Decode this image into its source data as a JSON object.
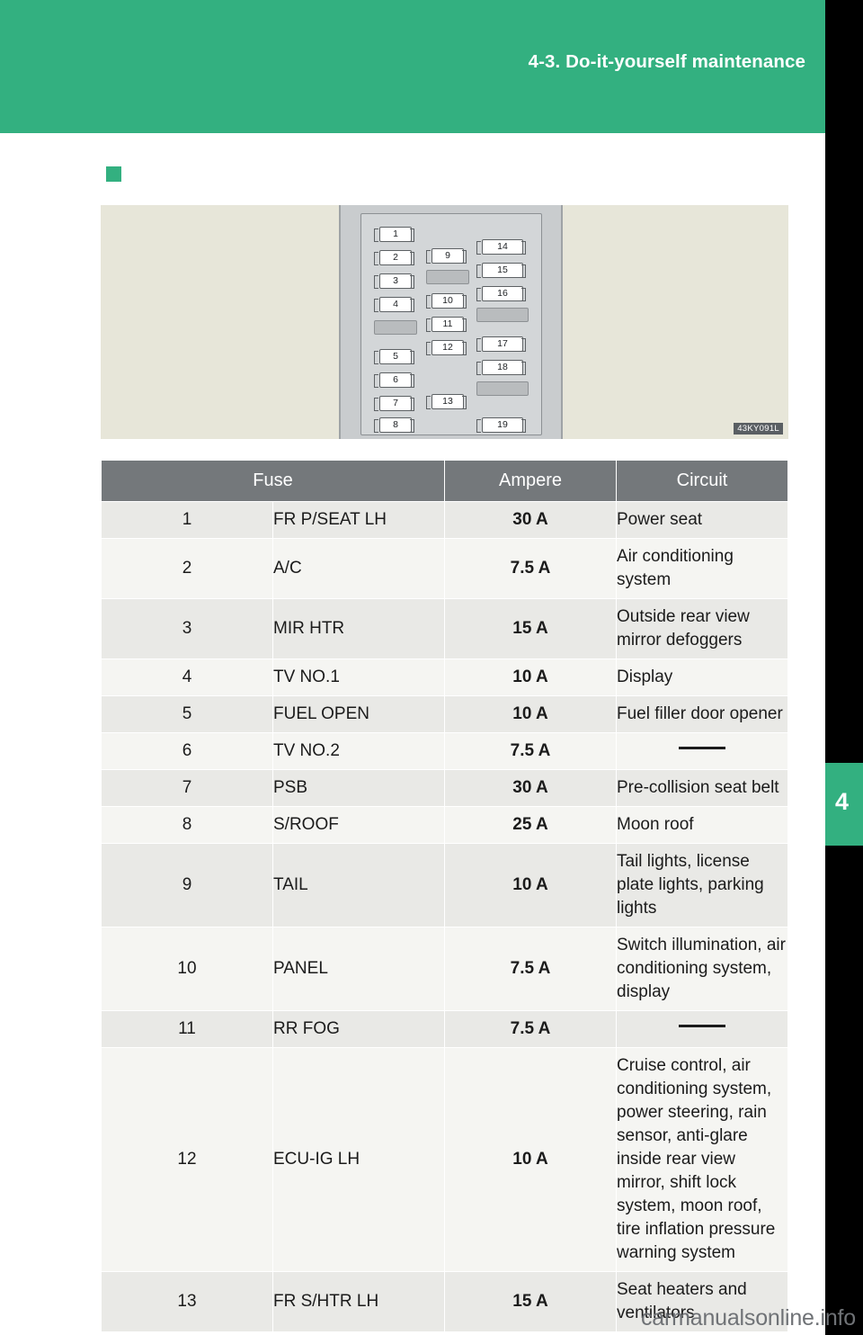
{
  "header": {
    "title": "4-3. Do-it-yourself maintenance",
    "chapter_number": "4",
    "accent_color": "#33b080"
  },
  "illustration": {
    "code_label": "43KY091L",
    "fuse_numbers_left": [
      "1",
      "2",
      "3",
      "4",
      "5",
      "6",
      "7",
      "8"
    ],
    "fuse_numbers_middle": [
      "9",
      "10",
      "11",
      "12",
      "13"
    ],
    "fuse_numbers_right": [
      "14",
      "15",
      "16",
      "17",
      "18",
      "19"
    ]
  },
  "table": {
    "headers": {
      "fuse": "Fuse",
      "ampere": "Ampere",
      "circuit": "Circuit"
    },
    "rows": [
      {
        "num": "1",
        "name": "FR P/SEAT LH",
        "amp": "30 A",
        "circuit": "Power seat"
      },
      {
        "num": "2",
        "name": "A/C",
        "amp": "7.5 A",
        "circuit": "Air conditioning system"
      },
      {
        "num": "3",
        "name": "MIR HTR",
        "amp": "15 A",
        "circuit": "Outside rear view mirror defoggers"
      },
      {
        "num": "4",
        "name": "TV NO.1",
        "amp": "10 A",
        "circuit": "Display"
      },
      {
        "num": "5",
        "name": "FUEL OPEN",
        "amp": "10 A",
        "circuit": "Fuel filler door opener"
      },
      {
        "num": "6",
        "name": "TV NO.2",
        "amp": "7.5 A",
        "circuit": ""
      },
      {
        "num": "7",
        "name": "PSB",
        "amp": "30 A",
        "circuit": "Pre-collision seat belt"
      },
      {
        "num": "8",
        "name": "S/ROOF",
        "amp": "25 A",
        "circuit": "Moon roof"
      },
      {
        "num": "9",
        "name": "TAIL",
        "amp": "10 A",
        "circuit": "Tail lights, license plate lights, parking lights"
      },
      {
        "num": "10",
        "name": "PANEL",
        "amp": "7.5 A",
        "circuit": "Switch illumination, air conditioning system, display"
      },
      {
        "num": "11",
        "name": "RR FOG",
        "amp": "7.5 A",
        "circuit": ""
      },
      {
        "num": "12",
        "name": "ECU-IG LH",
        "amp": "10 A",
        "circuit": "Cruise control, air conditioning system, power steering, rain sensor, anti-glare inside rear view mirror, shift lock system, moon roof, tire inflation pressure warning system"
      },
      {
        "num": "13",
        "name": "FR S/HTR LH",
        "amp": "15 A",
        "circuit": "Seat heaters and ventilators"
      }
    ]
  },
  "footer": {
    "watermark": "carmanualsonline.info"
  }
}
